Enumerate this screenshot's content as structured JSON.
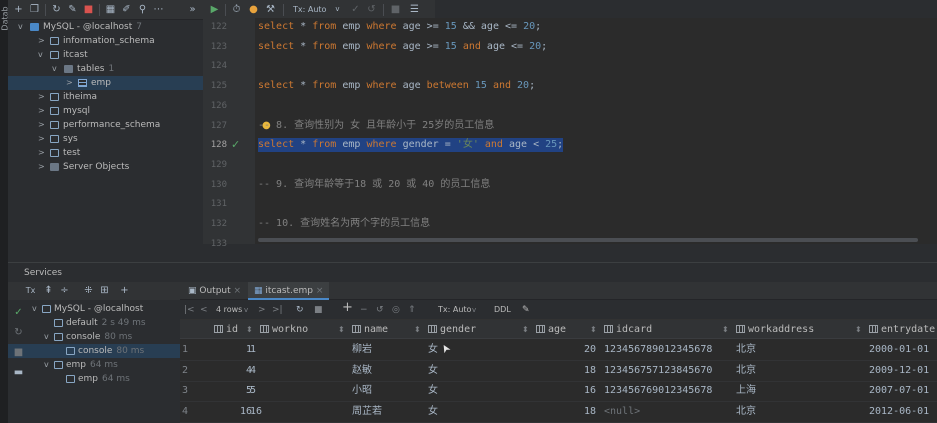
{
  "side_stripe": {
    "label": "Datab"
  },
  "toolbar": {
    "tx_mode": "Tx: Auto",
    "icons": [
      "plus-icon",
      "copy-icon",
      "refresh-icon",
      "edit-icon",
      "stop-icon",
      "table-icon",
      "pencil-icon",
      "filter-icon",
      "more-icon",
      "run-icon",
      "history-icon",
      "commit-icon",
      "wrench-icon"
    ]
  },
  "tree": {
    "items": [
      {
        "label": "MySQL - @localhost",
        "badge": "7",
        "level": 0,
        "expanded": true,
        "icon": "mysql-icon"
      },
      {
        "label": "information_schema",
        "badge": "",
        "level": 1,
        "expanded": false,
        "icon": "schema-icon"
      },
      {
        "label": "itcast",
        "badge": "",
        "level": 1,
        "expanded": true,
        "icon": "schema-icon"
      },
      {
        "label": "tables",
        "badge": "1",
        "level": 2,
        "expanded": true,
        "icon": "folder-icon"
      },
      {
        "label": "emp",
        "badge": "",
        "level": 3,
        "expanded": false,
        "icon": "table-icon",
        "selected": true
      },
      {
        "label": "itheima",
        "badge": "",
        "level": 1,
        "expanded": false,
        "icon": "schema-icon"
      },
      {
        "label": "mysql",
        "badge": "",
        "level": 1,
        "expanded": false,
        "icon": "schema-icon"
      },
      {
        "label": "performance_schema",
        "badge": "",
        "level": 1,
        "expanded": false,
        "icon": "schema-icon"
      },
      {
        "label": "sys",
        "badge": "",
        "level": 1,
        "expanded": false,
        "icon": "schema-icon"
      },
      {
        "label": "test",
        "badge": "",
        "level": 1,
        "expanded": false,
        "icon": "schema-icon"
      },
      {
        "label": "Server Objects",
        "badge": "",
        "level": 1,
        "expanded": false,
        "icon": "server-icon"
      }
    ]
  },
  "editor": {
    "lines": [
      {
        "num": "122",
        "text": "select * from emp where age >= 15 && age <= 20;"
      },
      {
        "num": "123",
        "text": "select * from emp where age >= 15 and age <= 20;"
      },
      {
        "num": "124",
        "text": ""
      },
      {
        "num": "125",
        "text": "select * from emp where age between 15 and 20;"
      },
      {
        "num": "126",
        "text": ""
      },
      {
        "num": "127",
        "text": "-- 8. 查询性别为 女 且年龄小于 25岁的员工信息"
      },
      {
        "num": "128",
        "text": "select * from emp where gender = '女' and age < 25;"
      },
      {
        "num": "129",
        "text": ""
      },
      {
        "num": "130",
        "text": "-- 9. 查询年龄等于18 或 20 或 40 的员工信息"
      },
      {
        "num": "131",
        "text": ""
      },
      {
        "num": "132",
        "text": "-- 10. 查询姓名为两个字的员工信息"
      },
      {
        "num": "133",
        "text": ""
      }
    ]
  },
  "services": {
    "title": "Services",
    "tree": [
      {
        "label": "MySQL - @localhost",
        "badge": ""
      },
      {
        "label": "default",
        "badge": "2 s 49 ms"
      },
      {
        "label": "console",
        "badge": "80 ms"
      },
      {
        "label": "console",
        "badge": "80 ms"
      },
      {
        "label": "emp",
        "badge": "64 ms"
      },
      {
        "label": "emp",
        "badge": "64 ms"
      }
    ]
  },
  "tabs": [
    {
      "label": "Output"
    },
    {
      "label": "itcast.emp"
    }
  ],
  "results": {
    "rows_label": "4 rows",
    "tx_mode": "Tx: Auto",
    "ddl_label": "DDL",
    "columns": [
      "id",
      "workno",
      "name",
      "gender",
      "age",
      "idcard",
      "workaddress",
      "entrydate"
    ],
    "rows": [
      {
        "n": "1",
        "id": "1",
        "workno": "1",
        "name": "柳岩",
        "gender": "女",
        "age": "20",
        "idcard": "123456789012345678",
        "workaddress": "北京",
        "entrydate": "2000-01-01"
      },
      {
        "n": "2",
        "id": "4",
        "workno": "4",
        "name": "赵敏",
        "gender": "女",
        "age": "18",
        "idcard": "123456757123845670",
        "workaddress": "北京",
        "entrydate": "2009-12-01"
      },
      {
        "n": "3",
        "id": "5",
        "workno": "5",
        "name": "小昭",
        "gender": "女",
        "age": "16",
        "idcard": "123456769012345678",
        "workaddress": "上海",
        "entrydate": "2007-07-01"
      },
      {
        "n": "4",
        "id": "16",
        "workno": "16",
        "name": "周芷若",
        "gender": "女",
        "age": "18",
        "idcard": "<null>",
        "workaddress": "北京",
        "entrydate": "2012-06-01"
      }
    ]
  }
}
